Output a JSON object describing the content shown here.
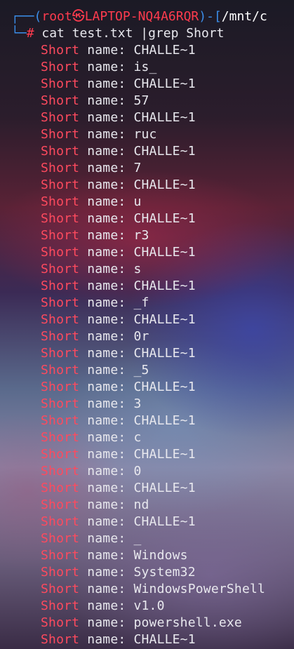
{
  "prompt": {
    "corner_top": "┌──(",
    "user_host": "root㉿LAPTOP-NQ4A6RQR",
    "sep": ")-[",
    "cwd": "/mnt/c",
    "corner_bottom": "└─",
    "hash": "#",
    "command": " cat test.txt |grep Short"
  },
  "output": {
    "keyword": "Short",
    "label": " name: ",
    "values": [
      "CHALLE~1",
      "is_",
      "CHALLE~1",
      "57",
      "CHALLE~1",
      "ruc",
      "CHALLE~1",
      "7",
      "CHALLE~1",
      "u",
      "CHALLE~1",
      "r3",
      "CHALLE~1",
      "s",
      "CHALLE~1",
      "_f",
      "CHALLE~1",
      "0r",
      "CHALLE~1",
      "_5",
      "CHALLE~1",
      "3",
      "CHALLE~1",
      "c",
      "CHALLE~1",
      "0",
      "CHALLE~1",
      "nd",
      "CHALLE~1",
      "_",
      "Windows",
      "System32",
      "WindowsPowerShell",
      "v1.0",
      "powershell.exe",
      "CHALLE~1"
    ]
  },
  "colors": {
    "keyword": "#ff4a5e",
    "text": "#e8e8ee",
    "prompt_box": "#3b8eea",
    "prompt_user": "#ff3b4e"
  }
}
